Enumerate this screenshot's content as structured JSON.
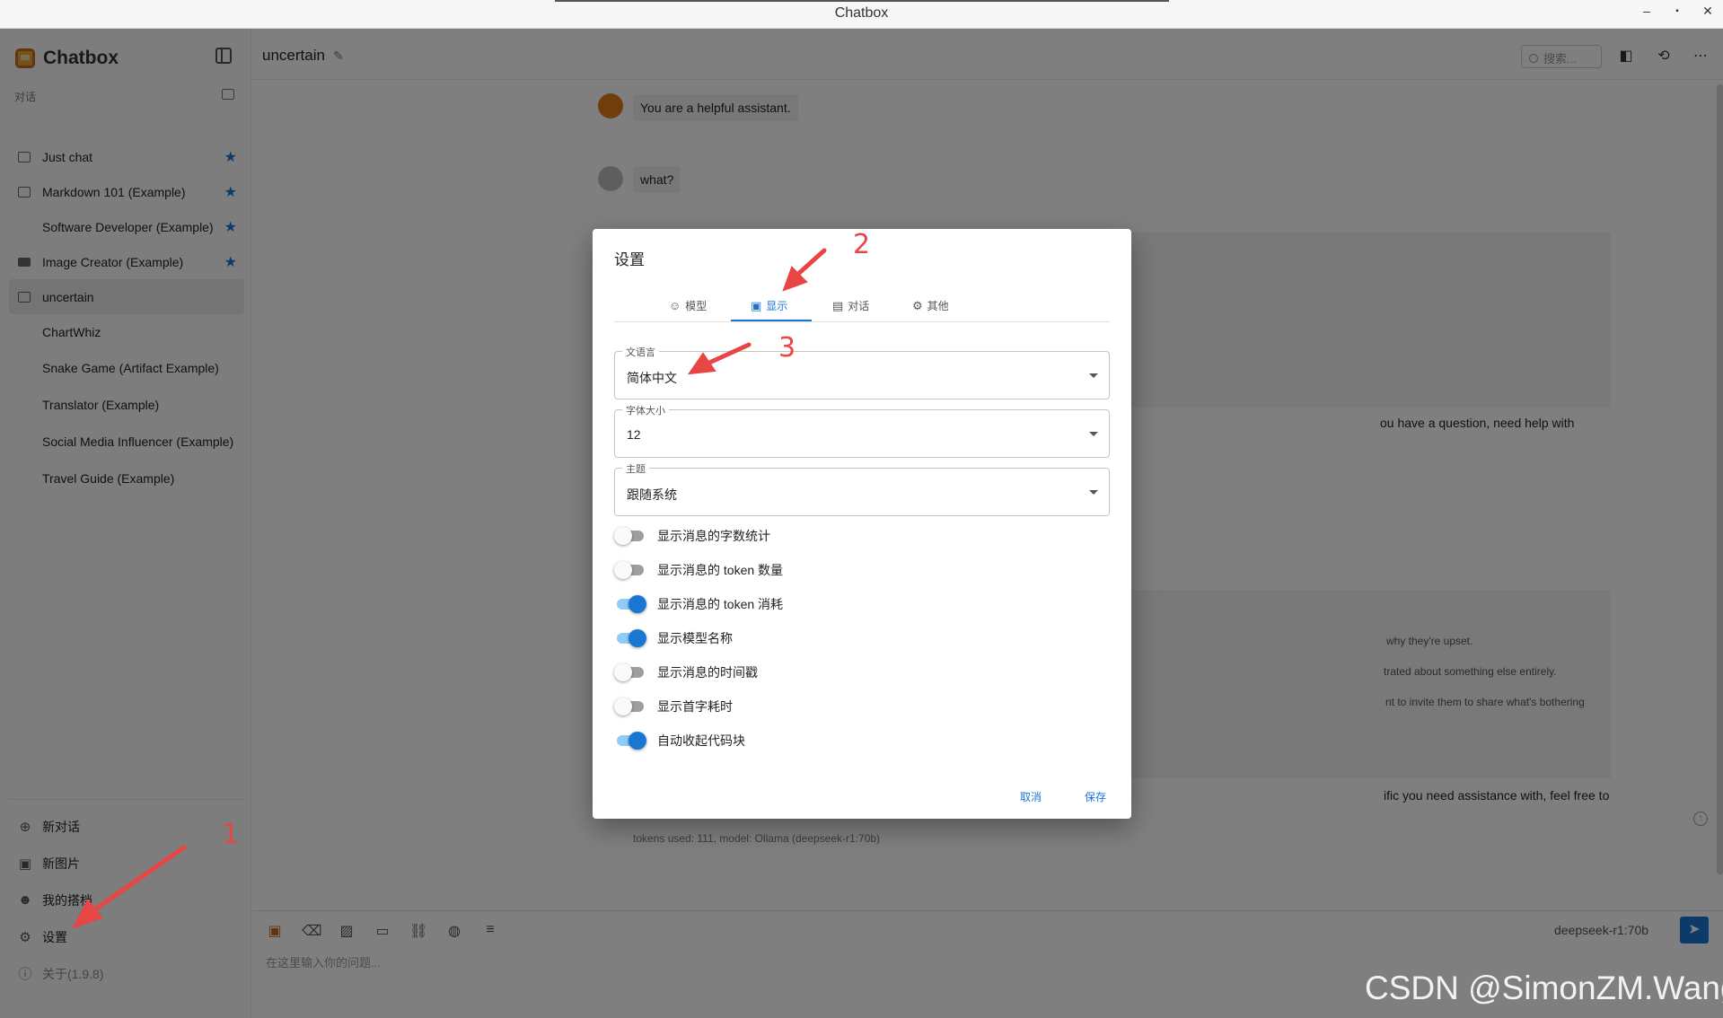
{
  "window": {
    "title": "Chatbox",
    "controls": [
      "–",
      "▪",
      "✕"
    ]
  },
  "sidebar": {
    "brand": "Chatbox",
    "section_label": "对话",
    "conversations": [
      {
        "label": "Just chat",
        "icon": "chat-bubble-icon",
        "starred": true,
        "active": false
      },
      {
        "label": "Markdown 101 (Example)",
        "icon": "chat-bubble-icon",
        "starred": true,
        "active": false
      },
      {
        "label": "Software Developer (Example)",
        "icon": "",
        "starred": true,
        "active": false
      },
      {
        "label": "Image Creator (Example)",
        "icon": "image-icon",
        "starred": true,
        "active": false
      },
      {
        "label": "uncertain",
        "icon": "chat-bubble-icon",
        "starred": false,
        "active": true
      },
      {
        "label": "ChartWhiz",
        "icon": "",
        "starred": false,
        "active": false
      },
      {
        "label": "Snake Game (Artifact Example)",
        "icon": "",
        "starred": false,
        "active": false
      },
      {
        "label": "Translator (Example)",
        "icon": "",
        "starred": false,
        "active": false
      },
      {
        "label": "Social Media Influencer (Example)",
        "icon": "",
        "starred": false,
        "active": false
      },
      {
        "label": "Travel Guide (Example)",
        "icon": "",
        "starred": false,
        "active": false
      }
    ],
    "bottom": {
      "new_chat": "新对话",
      "new_image": "新图片",
      "my_copilots": "我的搭档",
      "settings": "设置",
      "about": "关于(1.9.8)"
    }
  },
  "main": {
    "conversation_title": "uncertain",
    "search_placeholder": "搜索...",
    "messages": {
      "system": "You are a helpful assistant.",
      "user": "what?",
      "frag1": "ou have a question, need help with",
      "frag2": "why they're upset.",
      "frag3": "trated about something else entirely.",
      "frag4": "nt to invite them to share what's bothering",
      "frag5": "ific you need assistance with, feel free to",
      "tokens": "tokens used: 111, model: Ollama (deepseek-r1:70b)"
    },
    "input": {
      "placeholder": "在这里输入你的问题...",
      "model": "deepseek-r1:70b"
    }
  },
  "dialog": {
    "title": "设置",
    "tabs": [
      {
        "label": "模型",
        "icon": "robot-icon"
      },
      {
        "label": "显示",
        "icon": "display-icon"
      },
      {
        "label": "对话",
        "icon": "chat-icon"
      },
      {
        "label": "其他",
        "icon": "gear-icon"
      }
    ],
    "active_tab": "显示",
    "fields": {
      "language": {
        "label": "语言",
        "value": "简体中文"
      },
      "font_size": {
        "label": "字体大小",
        "value": "12"
      },
      "theme": {
        "label": "主题",
        "value": "跟随系统"
      }
    },
    "toggles": [
      {
        "label": "显示消息的字数统计",
        "on": false
      },
      {
        "label": "显示消息的 token 数量",
        "on": false
      },
      {
        "label": "显示消息的 token 消耗",
        "on": true
      },
      {
        "label": "显示模型名称",
        "on": true
      },
      {
        "label": "显示消息的时间戳",
        "on": false
      },
      {
        "label": "显示首字耗时",
        "on": false
      },
      {
        "label": "自动收起代码块",
        "on": true
      }
    ],
    "cancel": "取消",
    "save": "保存"
  },
  "annotations": {
    "n1": "1",
    "n2": "2",
    "n3": "3",
    "color": "#e84545"
  },
  "watermark": "CSDN @SimonZM.Wang"
}
